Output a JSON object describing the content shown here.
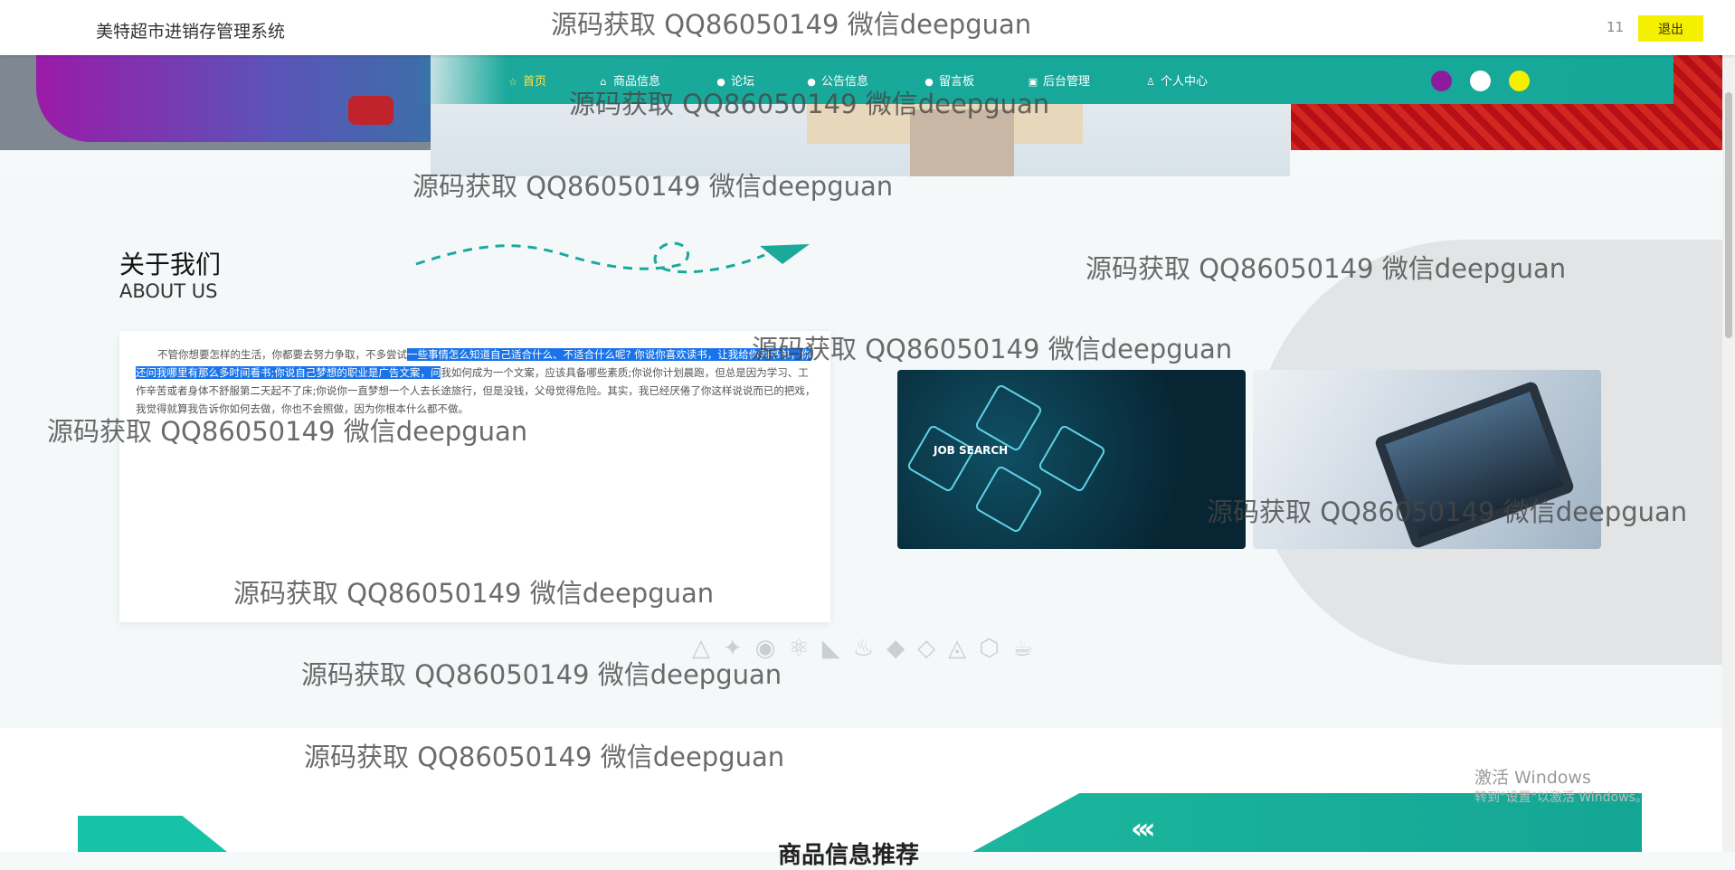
{
  "header": {
    "site_title": "美特超市进销存管理系统",
    "user_count": "11",
    "logout_label": "退出"
  },
  "nav": {
    "items": [
      {
        "label": "首页",
        "icon": "star-icon",
        "active": true
      },
      {
        "label": "商品信息",
        "icon": "home-icon"
      },
      {
        "label": "论坛",
        "icon": "circle-icon"
      },
      {
        "label": "公告信息",
        "icon": "circle-icon"
      },
      {
        "label": "留言板",
        "icon": "info-icon"
      },
      {
        "label": "后台管理",
        "icon": "briefcase-icon"
      },
      {
        "label": "个人中心",
        "icon": "user-icon"
      }
    ],
    "theme_colors": [
      "#8e1a9e",
      "#ffffff",
      "#f5ef00"
    ]
  },
  "about": {
    "title": "关于我们",
    "subtitle": "ABOUT US",
    "text_before": "不管你想要怎样的生活，你都要去努力争取，不多尝试",
    "text_highlight": "一些事情怎么知道自己适合什么、不适合什么呢? 你说你喜欢读书，让我给你列书单，你还问我哪里有那么多时间看书;你说自己梦想的职业是广告文案，问",
    "text_after": "我如何成为一个文案，应该具备哪些素质;你说你计划晨跑，但总是因为学习、工作辛苦或者身体不舒服第二天起不了床;你说你一直梦想一个人去长途旅行，但是没钱，父母觉得危险。其实，我已经厌倦了你这样说说而已的把戏，我觉得就算我告诉你如何去做，你也不会照做，因为你根本什么都不做。",
    "photo1_text": "JOB SEARCH"
  },
  "recommend": {
    "title": "商品信息推荐"
  },
  "watermark": "源码获取 QQ86050149 微信deepguan",
  "windows": {
    "line1": "激活 Windows",
    "line2": "转到\"设置\"以激活 Windows。"
  }
}
